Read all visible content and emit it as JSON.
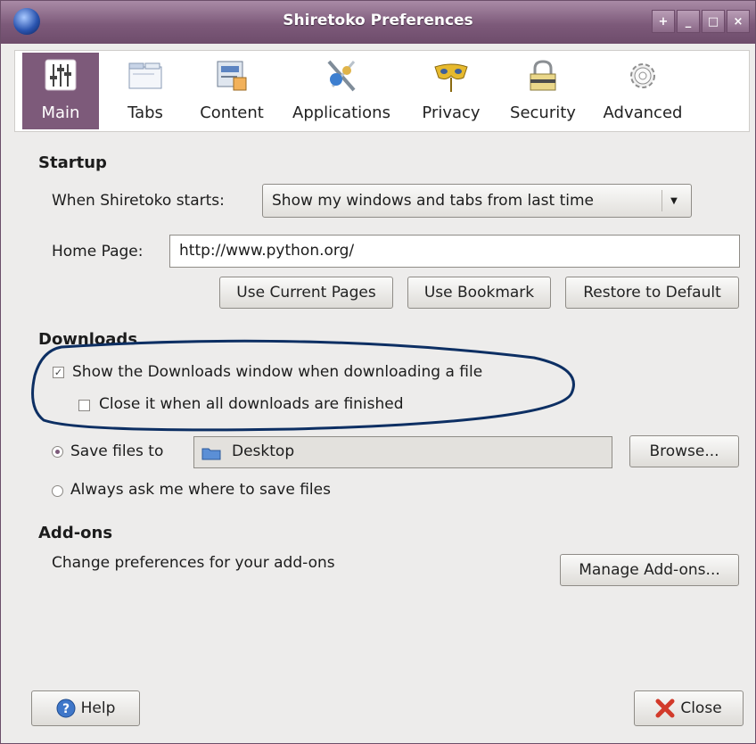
{
  "window": {
    "title": "Shiretoko Preferences",
    "buttons": [
      "+",
      "_",
      "□",
      "×"
    ]
  },
  "tabs": [
    {
      "label": "Main",
      "icon": "sliders-icon",
      "active": true
    },
    {
      "label": "Tabs",
      "icon": "tabs-icon",
      "active": false
    },
    {
      "label": "Content",
      "icon": "content-icon",
      "active": false
    },
    {
      "label": "Applications",
      "icon": "applications-icon",
      "active": false
    },
    {
      "label": "Privacy",
      "icon": "mask-icon",
      "active": false
    },
    {
      "label": "Security",
      "icon": "lock-icon",
      "active": false
    },
    {
      "label": "Advanced",
      "icon": "gear-icon",
      "active": false
    }
  ],
  "startup": {
    "heading": "Startup",
    "when_label": "When Shiretoko starts:",
    "when_value": "Show my windows and tabs from last time",
    "home_label": "Home Page:",
    "home_value": "http://www.python.org/",
    "use_current": "Use Current Pages",
    "use_bookmark": "Use Bookmark",
    "restore_default": "Restore to Default"
  },
  "downloads": {
    "heading": "Downloads",
    "show_window": "Show the Downloads window when downloading a file",
    "show_window_checked": true,
    "close_when_done": "Close it when all downloads are finished",
    "close_when_done_checked": false,
    "save_files_label": "Save files to",
    "save_files_value": "Desktop",
    "browse": "Browse...",
    "always_ask": "Always ask me where to save files"
  },
  "addons": {
    "heading": "Add-ons",
    "description": "Change preferences for your add-ons",
    "manage": "Manage Add-ons..."
  },
  "footer": {
    "help": "Help",
    "close": "Close"
  },
  "colors": {
    "accent": "#7d5a7a",
    "annotation": "#0d2f63"
  }
}
